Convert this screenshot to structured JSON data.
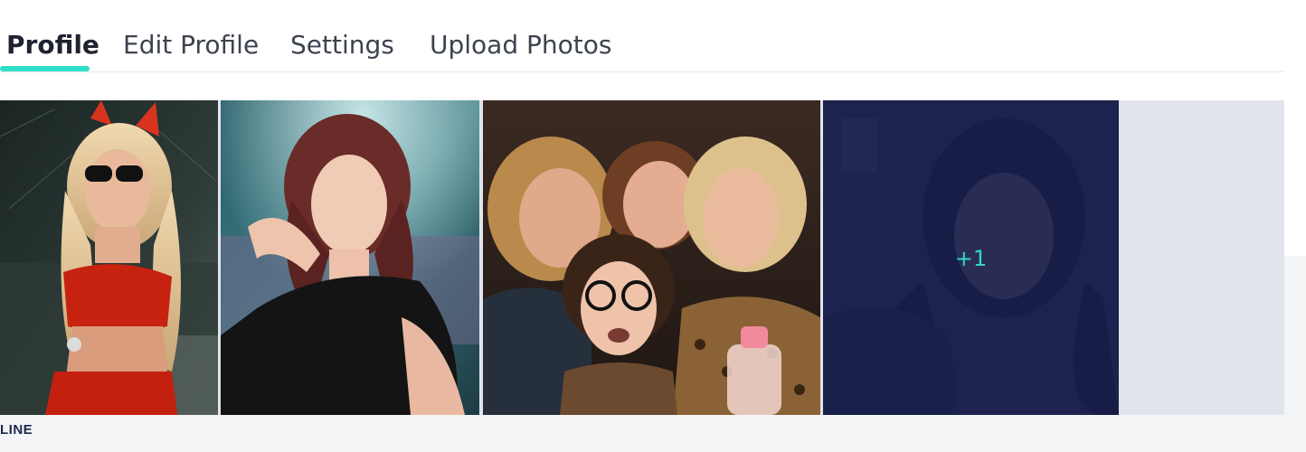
{
  "tabs": [
    {
      "label": "Profile",
      "active": true
    },
    {
      "label": "Edit Profile",
      "active": false
    },
    {
      "label": "Settings",
      "active": false
    },
    {
      "label": "Upload Photos",
      "active": false
    }
  ],
  "gallery": {
    "more_count": "+1"
  },
  "section_label": "LINE",
  "colors": {
    "accent": "#2fe0c8",
    "overlay": "#161e4e",
    "more_text": "#33d6c4"
  }
}
